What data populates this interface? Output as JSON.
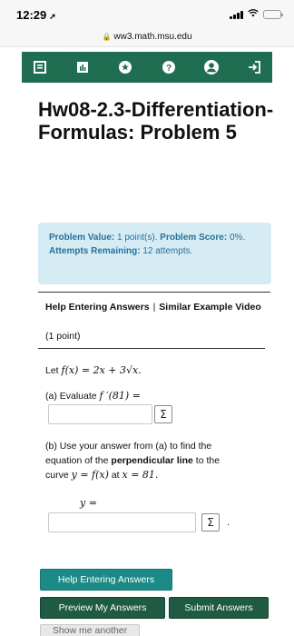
{
  "status_bar": {
    "time": "12:29",
    "location_icon": "location-arrow-icon",
    "signal_icon": "cellular-signal-icon",
    "wifi_icon": "wifi-icon",
    "battery_icon": "battery-icon"
  },
  "browser": {
    "url": "ww3.math.msu.edu",
    "lock_icon": "lock-icon"
  },
  "nav": {
    "icons": [
      "grades-icon",
      "stats-icon",
      "settings-icon",
      "help-icon",
      "user-icon",
      "sign-out-icon"
    ],
    "bg_color": "#1f6e52"
  },
  "page": {
    "title": "Hw08-2.3-Differentiation-Formulas: Problem 5"
  },
  "problem_info": {
    "value_label": "Problem Value:",
    "value_text": "1 point(s).",
    "score_label": "Problem Score:",
    "score_text": "0%.",
    "attempts_label": "Attempts Remaining:",
    "attempts_text": "12 attempts."
  },
  "help": {
    "entering_link": "Help Entering Answers",
    "separator": "|",
    "video_link": "Similar Example Video",
    "points": "(1 point)"
  },
  "question": {
    "let_prefix": "Let",
    "function_def": "f(x) = 2x + 3√x.",
    "part_a_prefix": "(a) Evaluate",
    "part_a_expr": "f ′(81) =",
    "part_b_line1": "(b) Use your answer from (a) to find the",
    "part_b_line2_pre": "equation of the",
    "part_b_line2_bold": "perpendicular line",
    "part_b_line2_post": "to the",
    "part_b_line3_pre": "curve",
    "part_b_curve_expr": "y = f(x)",
    "part_b_at": "at",
    "part_b_x_expr": "x = 81.",
    "y_equals": "y =",
    "period": "."
  },
  "answers": {
    "part_a_value": "",
    "part_b_value": "",
    "equation_editor_label": "Σ"
  },
  "buttons": {
    "help_entering": "Help Entering Answers",
    "preview": "Preview My Answers",
    "submit": "Submit Answers",
    "show_another": "Show me another"
  },
  "colors": {
    "nav_green": "#1f6e52",
    "info_bg": "#d5ecf5",
    "info_text": "#2a6f97",
    "teal_button": "#1c8a86",
    "dark_green_button": "#1f5a43"
  }
}
